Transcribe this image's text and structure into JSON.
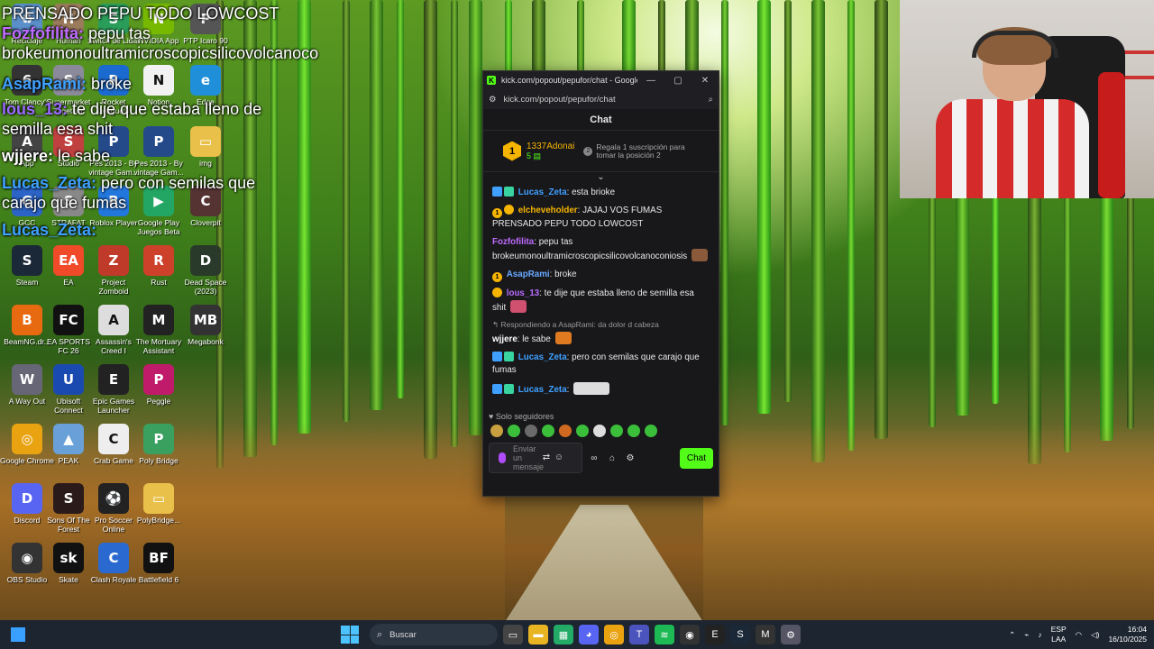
{
  "overlay_chat": {
    "line1": "PRENSADO PEPU TODO LOWCOST",
    "user1": "Fozfofilita:",
    "text1": " pepu tas",
    "line2": "brokeumonoultramicroscopicsilicovolcanoco",
    "user2": "AsapRami:",
    "text2": " broke",
    "user3": "lous_13:",
    "text3": " te dije que estaba lleno de",
    "line4": "semilla esa shit",
    "user4": "wjjere:",
    "text4": " le sabe",
    "user5": "Lucas_Zeta:",
    "text5": " pero con semilas que",
    "line6": "carajo que fumas",
    "user6": "Lucas_Zeta:"
  },
  "desktop_icons": [
    {
      "label": "Reciclaje",
      "color": "#5a8fc9",
      "glyph": "♻"
    },
    {
      "label": "Human",
      "color": "#9a7b5b",
      "glyph": "H"
    },
    {
      "label": "Switch de Lidar",
      "color": "#2a9d5a",
      "glyph": "S"
    },
    {
      "label": "NVIDIA App",
      "color": "#76b900",
      "glyph": "N"
    },
    {
      "label": "PTP Icaro 90",
      "color": "#555",
      "glyph": "P"
    },
    {
      "label": "Tom Clancy's",
      "color": "#333",
      "glyph": "6"
    },
    {
      "label": "Supermarket Together",
      "color": "#8a8a9a",
      "glyph": "S"
    },
    {
      "label": "Rocket League®",
      "color": "#1a6ad0",
      "glyph": "R"
    },
    {
      "label": "Notion",
      "color": "#f2f2f2",
      "glyph": "N"
    },
    {
      "label": "Edge",
      "color": "#1e8fd8",
      "glyph": "e"
    },
    {
      "label": "App",
      "color": "#444",
      "glyph": "A"
    },
    {
      "label": "Studio",
      "color": "#c04040",
      "glyph": "S"
    },
    {
      "label": "Pes 2013 - By vintage Gam...",
      "color": "#244a8a",
      "glyph": "P"
    },
    {
      "label": "Pes 2013 - By vintage Gam...",
      "color": "#244a8a",
      "glyph": "P"
    },
    {
      "label": "img",
      "color": "#e9c04a",
      "glyph": "▭"
    },
    {
      "label": "GCC",
      "color": "#2b63c6",
      "glyph": "G"
    },
    {
      "label": "STRAFAT",
      "color": "#888",
      "glyph": "S"
    },
    {
      "label": "Roblox Player",
      "color": "#2277dd",
      "glyph": "R"
    },
    {
      "label": "Google Play Juegos Beta",
      "color": "#23a563",
      "glyph": "▶"
    },
    {
      "label": "Cloverpit",
      "color": "#553333",
      "glyph": "C"
    },
    {
      "label": "Steam",
      "color": "#1b2838",
      "glyph": "S"
    },
    {
      "label": "EA",
      "color": "#f04a28",
      "glyph": "EA"
    },
    {
      "label": "Project Zomboid",
      "color": "#c03a2a",
      "glyph": "Z"
    },
    {
      "label": "Rust",
      "color": "#cd412b",
      "glyph": "R"
    },
    {
      "label": "Dead Space (2023)",
      "color": "#2a3a2a",
      "glyph": "D"
    },
    {
      "label": "BeamNG.dr...",
      "color": "#e86a10",
      "glyph": "B"
    },
    {
      "label": "EA SPORTS FC 26",
      "color": "#111",
      "glyph": "FC"
    },
    {
      "label": "Assassin's Creed I",
      "color": "#ddd",
      "glyph": "A"
    },
    {
      "label": "The Mortuary Assistant",
      "color": "#222",
      "glyph": "M"
    },
    {
      "label": "Megabonk",
      "color": "#333",
      "glyph": "MB"
    },
    {
      "label": "A Way Out",
      "color": "#667",
      "glyph": "W"
    },
    {
      "label": "Ubisoft Connect",
      "color": "#1a4ab0",
      "glyph": "U"
    },
    {
      "label": "Epic Games Launcher",
      "color": "#222",
      "glyph": "E"
    },
    {
      "label": "Peggle",
      "color": "#c01a6a",
      "glyph": "P"
    },
    {
      "label": "Google Chrome",
      "color": "#e9a210",
      "glyph": "◎"
    },
    {
      "label": "PEAK",
      "color": "#6aa0d8",
      "glyph": "▲"
    },
    {
      "label": "Crab Game",
      "color": "#eee",
      "glyph": "C"
    },
    {
      "label": "Poly Bridge",
      "color": "#3aa060",
      "glyph": "P"
    },
    {
      "label": "Discord",
      "color": "#5865f2",
      "glyph": "D"
    },
    {
      "label": "Sons Of The Forest",
      "color": "#2a1a1a",
      "glyph": "S"
    },
    {
      "label": "Pro Soccer Online",
      "color": "#222",
      "glyph": "⚽"
    },
    {
      "label": "PolyBridge...",
      "color": "#e9c04a",
      "glyph": "▭"
    },
    {
      "label": "OBS Studio",
      "color": "#333",
      "glyph": "◉"
    },
    {
      "label": "Skate",
      "color": "#111",
      "glyph": "sk"
    },
    {
      "label": "Clash Royale",
      "color": "#2a6ad0",
      "glyph": "C"
    },
    {
      "label": "Battlefield 6",
      "color": "#111",
      "glyph": "BF"
    }
  ],
  "window": {
    "title": "kick.com/popout/pepufor/chat - Google...",
    "url": "kick.com/popout/pepufor/chat",
    "minimize": "—",
    "maximize": "▢",
    "close": "✕",
    "chat_header": "Chat",
    "pinned_rank": "1",
    "pinned_user": "1337Adonai",
    "pinned_count": "5",
    "gift_text_1": "Regala 1 suscripción para",
    "gift_text_2": "tomar la posición 2"
  },
  "messages": [
    {
      "user": "Lucas_Zeta",
      "text": ": esta brioke"
    },
    {
      "user": "elcheveholder",
      "text": ": JAJAJ VOS FUMAS PRENSADO PEPU TODO LOWCOST"
    },
    {
      "user": "Fozfofilita",
      "text": ": pepu tas brokeumonoultramicroscopicsilicovolcanoconiosis"
    },
    {
      "user": "AsapRami",
      "text": ": broke"
    },
    {
      "user": "lous_13",
      "text": ": te dije que estaba lleno de semilla esa shit"
    },
    {
      "reply": "Respondiendo a AsapRami: da dolor d cabeza",
      "user": "wjjere",
      "text": ": le sabe"
    },
    {
      "user": "Lucas_Zeta",
      "text": ": pero con semilas que carajo que fumas"
    },
    {
      "user": "Lucas_Zeta",
      "text": ":"
    }
  ],
  "footer": {
    "followers": "Solo seguidores",
    "input_placeholder": "Enviar un mensaje",
    "send": "Chat"
  },
  "taskbar": {
    "search": "Buscar",
    "lang1": "ESP",
    "lang2": "LAA",
    "time": "16:04",
    "date": "16/10/2025"
  }
}
